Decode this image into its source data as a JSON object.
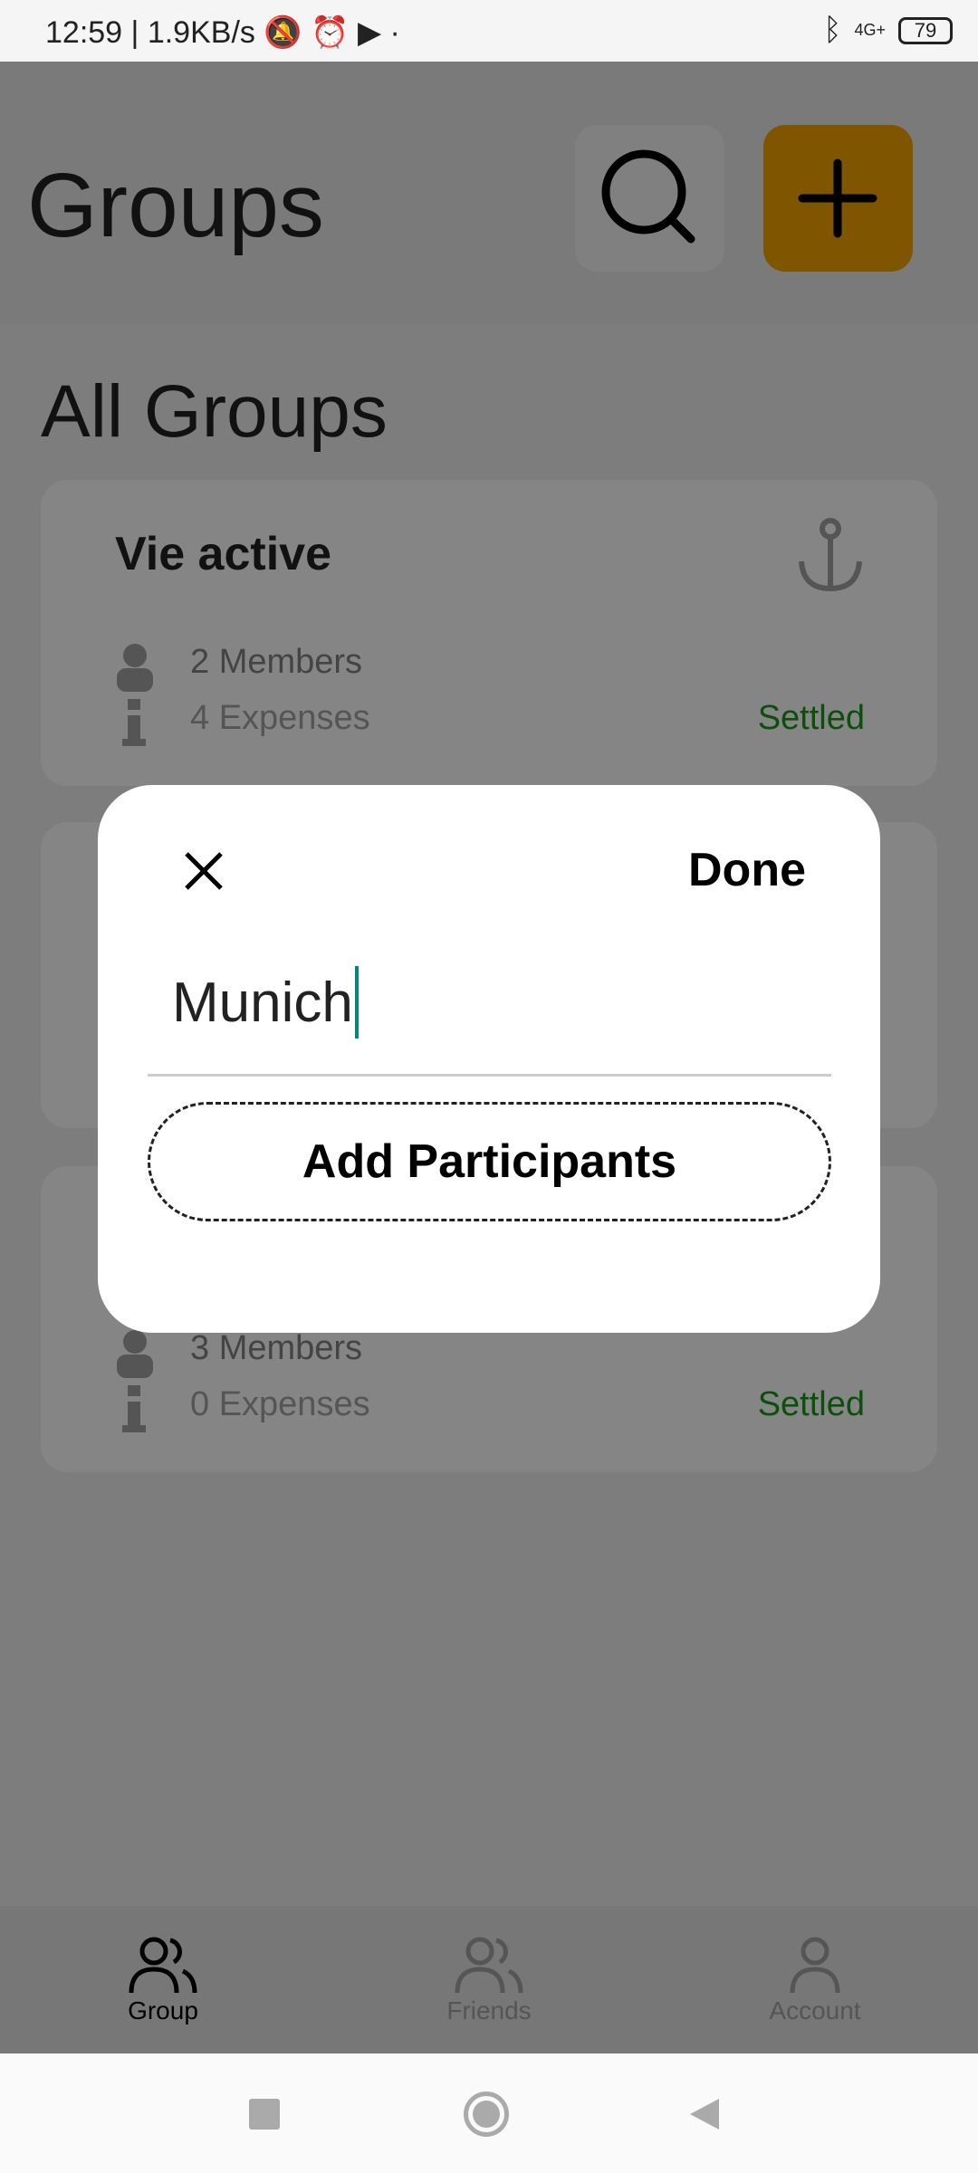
{
  "status_bar": {
    "time": "12:59",
    "speed": "1.9KB/s",
    "network": "4G+",
    "battery": "79"
  },
  "header": {
    "title": "Groups",
    "search_icon": "search-icon",
    "add_icon": "plus-icon",
    "accent": "#f5a400"
  },
  "section_title": "All Groups",
  "groups": [
    {
      "name": "Vie active",
      "members": "2 Members",
      "expenses": "4 Expenses",
      "status": "Settled"
    },
    {
      "name": "",
      "members": "",
      "expenses": "",
      "status": ""
    },
    {
      "name": "",
      "members": "3 Members",
      "expenses": "0 Expenses",
      "status": "Settled"
    }
  ],
  "modal": {
    "done_label": "Done",
    "input_value": "Munich",
    "add_participants_label": "Add Participants",
    "caret_color": "#00897b"
  },
  "bottom_nav": {
    "items": [
      {
        "label": "Group",
        "active": true
      },
      {
        "label": "Friends"
      },
      {
        "label": "Account"
      }
    ]
  },
  "colors": {
    "settled": "#0b7a0b"
  }
}
